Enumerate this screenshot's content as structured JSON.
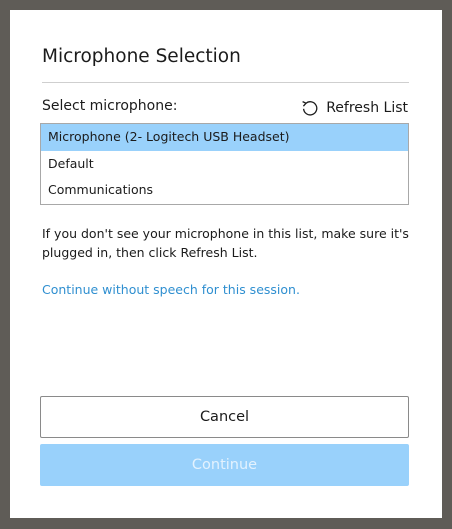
{
  "dialog": {
    "title": "Microphone Selection",
    "select_label": "Select microphone:",
    "refresh_label": "Refresh List",
    "refresh_icon": "refresh-icon",
    "microphones": [
      {
        "label": "Microphone (2- Logitech USB Headset)",
        "selected": true
      },
      {
        "label": "Default",
        "selected": false
      },
      {
        "label": "Communications",
        "selected": false
      }
    ],
    "help_text": "If you don't see your microphone in this list, make sure it's plugged in, then click Refresh List.",
    "continue_without_speech": "Continue without speech for this session.",
    "cancel_label": "Cancel",
    "continue_label": "Continue",
    "continue_disabled": true
  },
  "colors": {
    "backdrop": "#5f5c57",
    "selected_item": "#99d1fb",
    "link": "#2f8fd0",
    "primary_disabled": "#99d1fb"
  }
}
